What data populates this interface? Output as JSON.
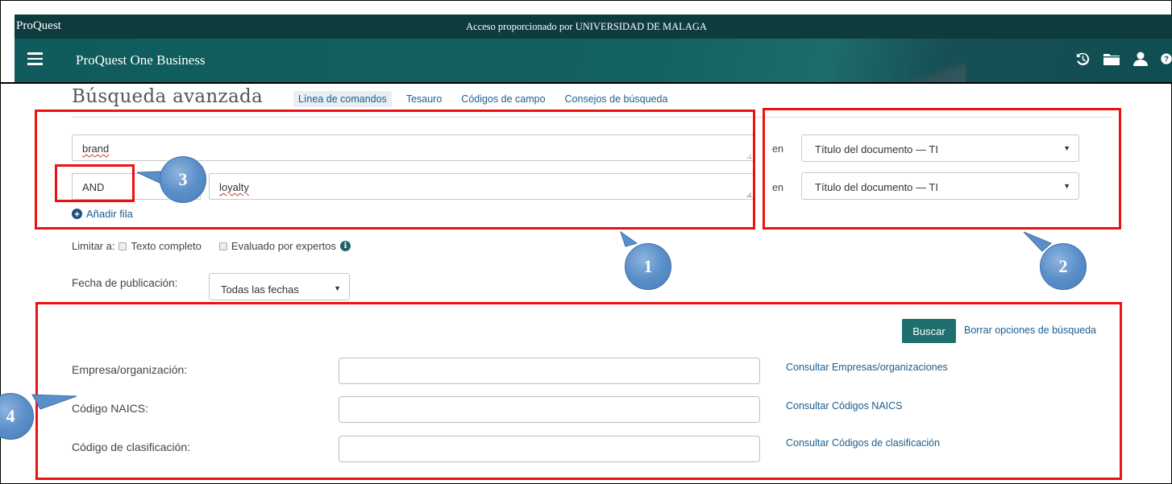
{
  "topbar": {
    "brand": "ProQuest",
    "access": "Acceso proporcionado por UNIVERSIDAD DE MALAGA"
  },
  "navbar": {
    "product": "ProQuest One Business",
    "icons": [
      "history-icon",
      "folder-icon",
      "user-icon",
      "help-icon"
    ]
  },
  "page": {
    "title": "Búsqueda avanzada",
    "tabs": [
      {
        "label": "Línea de comandos",
        "active": true
      },
      {
        "label": "Tesauro"
      },
      {
        "label": "Códigos de campo"
      },
      {
        "label": "Consejos de búsqueda"
      }
    ]
  },
  "search": {
    "rows": [
      {
        "value": "brand",
        "field_prefix": "en",
        "field": "Título del documento — TI"
      },
      {
        "operator": "AND",
        "value": "loyalty",
        "field_prefix": "en",
        "field": "Título del documento — TI"
      }
    ],
    "add_row": "Añadir fila"
  },
  "limit": {
    "label": "Limitar a:",
    "full_text": "Texto completo",
    "peer_reviewed": "Evaluado por expertos"
  },
  "date": {
    "label": "Fecha de publicación:",
    "value": "Todas las fechas"
  },
  "actions": {
    "search": "Buscar",
    "clear": "Borrar opciones de búsqueda"
  },
  "fields": [
    {
      "label": "Empresa/organización:",
      "link": "Consultar Empresas/organizaciones"
    },
    {
      "label": "Código NAICS:",
      "link": "Consultar Códigos NAICS"
    },
    {
      "label": "Código de clasificación:",
      "link": "Consultar Códigos de clasificación"
    }
  ],
  "annotations": {
    "colors": {
      "box": "#ee1111",
      "callout": "#5b8fc9"
    },
    "callouts": [
      "1",
      "2",
      "3",
      "4"
    ]
  }
}
